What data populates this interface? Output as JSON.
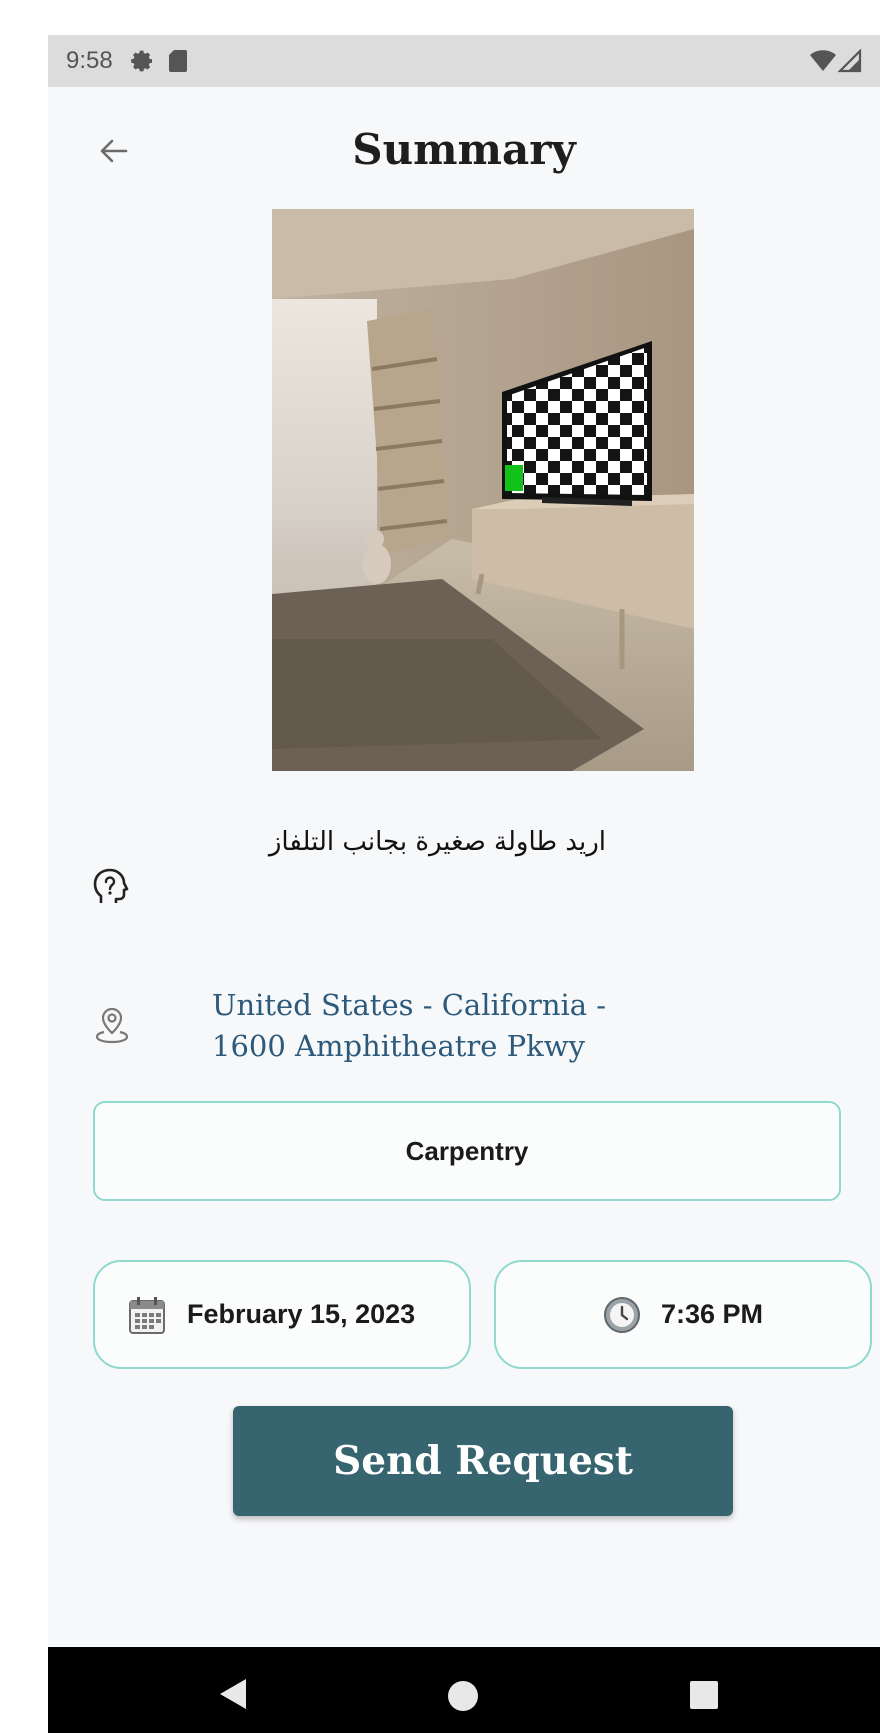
{
  "status_bar": {
    "time": "9:58"
  },
  "header": {
    "title": "Summary"
  },
  "request": {
    "description": "اريد طاولة صغيرة بجانب التلفاز",
    "location_line1": "United States - California -",
    "location_line2": "1600 Amphitheatre Pkwy",
    "category": "Carpentry",
    "date": "February 15, 2023",
    "time": "7:36 PM"
  },
  "actions": {
    "send_label": "Send Request"
  },
  "colors": {
    "accent_border": "#8fd9cf",
    "button_bg": "#36646f",
    "location_text": "#2c5a7c"
  }
}
